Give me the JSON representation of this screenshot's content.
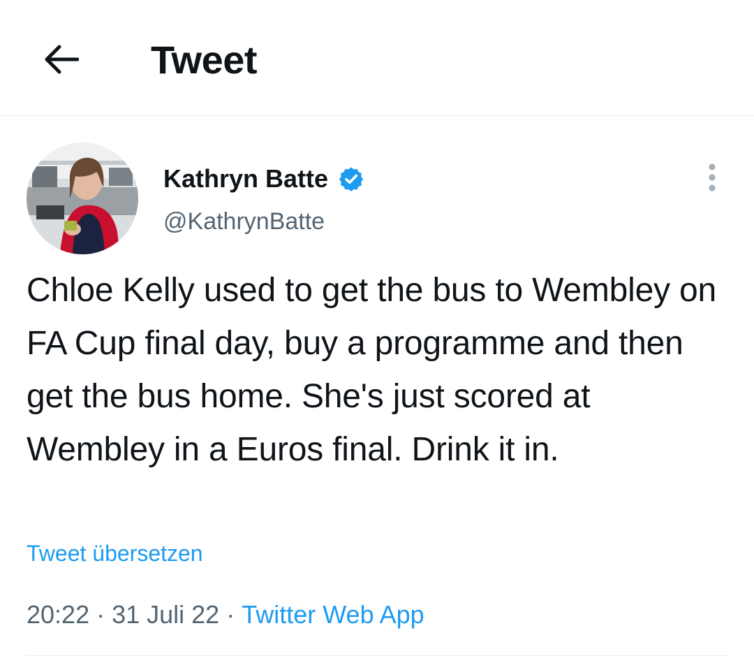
{
  "header": {
    "title": "Tweet",
    "back_icon": "arrow-left-icon"
  },
  "author": {
    "display_name": "Kathryn Batte",
    "handle": "@KathrynBatte",
    "verified": true,
    "verified_icon": "verified-badge-icon",
    "verified_color": "#1d9bf0"
  },
  "tweet": {
    "text": "Chloe Kelly used to get the bus to Wembley on FA Cup final day, buy a programme and then get the bus home. She's just scored at Wembley in a Euros final. Drink it in.",
    "translate_label": "Tweet übersetzen",
    "time": "20:22",
    "date": "31 Juli 22",
    "source": "Twitter Web App",
    "separator": "·"
  },
  "more_icon": "more-vertical-icon",
  "colors": {
    "accent": "#1d9bf0",
    "secondary_text": "#536471",
    "primary_text": "#0f1419",
    "divider": "#e6ecf0"
  }
}
